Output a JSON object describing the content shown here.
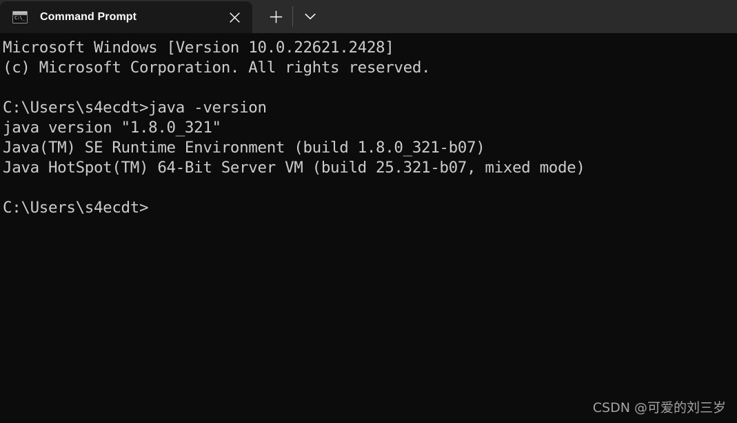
{
  "titlebar": {
    "tab": {
      "title": "Command Prompt",
      "icon_name": "console-icon",
      "icon_glyph": "C:\\_",
      "close_label": "Close tab"
    },
    "new_tab_label": "New tab",
    "dropdown_label": "Open new tab dropdown"
  },
  "console": {
    "lines": [
      "Microsoft Windows [Version 10.0.22621.2428]",
      "(c) Microsoft Corporation. All rights reserved.",
      "",
      "C:\\Users\\s4ecdt>java -version",
      "java version \"1.8.0_321\"",
      "Java(TM) SE Runtime Environment (build 1.8.0_321-b07)",
      "Java HotSpot(TM) 64-Bit Server VM (build 25.321-b07, mixed mode)",
      "",
      "C:\\Users\\s4ecdt>"
    ]
  },
  "watermark": {
    "text": "CSDN @可爱的刘三岁"
  },
  "colors": {
    "titlebar_bg": "#2b2b2b",
    "active_tab_bg": "#191919",
    "console_bg": "#0c0c0c",
    "console_text": "#cccccc",
    "tab_title_text": "#ffffff"
  }
}
